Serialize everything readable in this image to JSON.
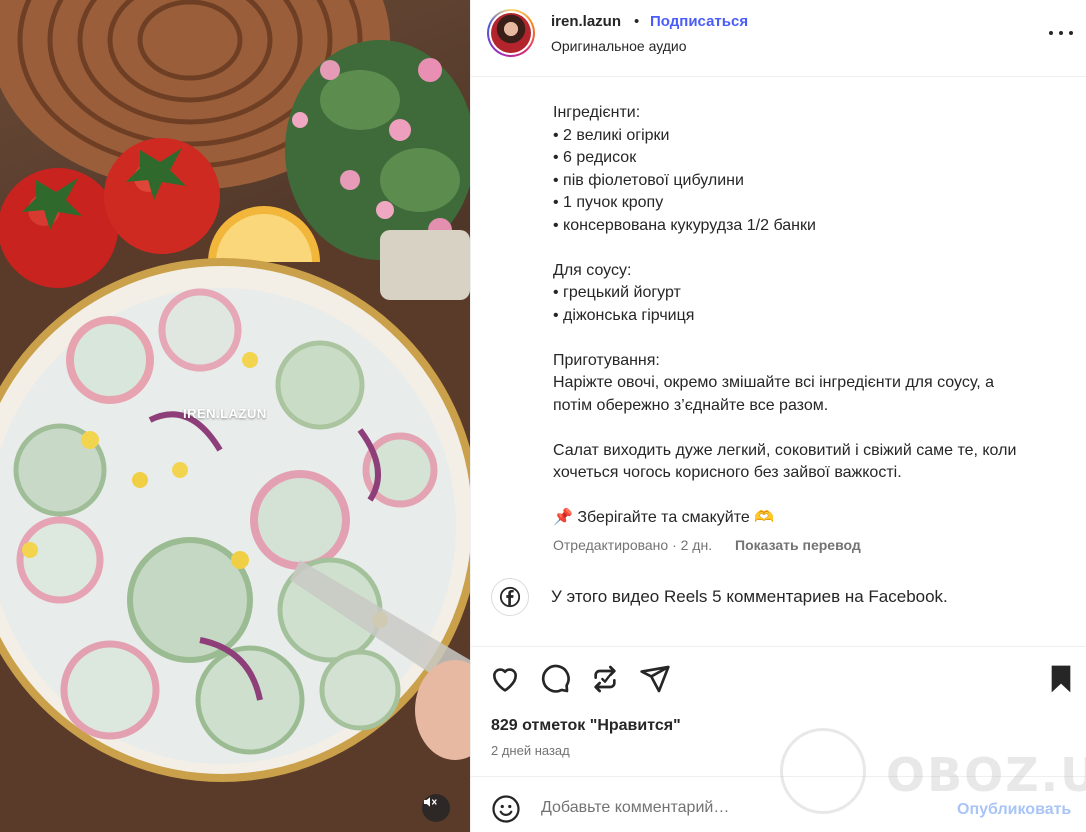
{
  "media": {
    "watermark": "IREN.LAZUN",
    "mute_icon": "speaker-muted-icon"
  },
  "header": {
    "username": "iren.lazun",
    "separator": "•",
    "follow_label": "Подписаться",
    "audio_label": "Оригинальное аудио",
    "more_icon": "more-horizontal-icon"
  },
  "caption": {
    "lines": [
      "Інгредієнти:",
      "• 2 великі огірки",
      "• 6 редисок",
      "• пів фіолетової цибулини",
      "• 1 пучок кропу",
      "• консервована кукурудза 1/2 банки",
      "",
      "Для соусу:",
      "• грецький йогурт",
      "• діжонська гірчиця",
      "",
      "Приготування:",
      "Наріжте овочі, окремо змішайте всі інгредієнти для соусу, а",
      "потім обережно з’єднайте все разом.",
      "",
      "Салат виходить дуже легкий, соковитий і свіжий саме те, коли",
      "хочеться чогось корисного без зайвої важкості.",
      "",
      "📌 Зберігайте та смакуйте 🫶"
    ],
    "meta": "Отредактировано · 2 дн.",
    "translate_label": "Показать перевод"
  },
  "facebook": {
    "icon": "facebook-icon",
    "text": "У этого видео Reels 5 комментариев на Facebook."
  },
  "actions": {
    "like_icon": "heart-icon",
    "comment_icon": "comment-icon",
    "share_icon": "repost-icon",
    "send_icon": "send-icon",
    "save_icon": "bookmark-icon",
    "likes_text": "829 отметок \"Нравится\"",
    "time_text": "2 дней назад"
  },
  "comment": {
    "emoji_icon": "emoji-icon",
    "placeholder": "Добавьте комментарий…",
    "publish_label": "Опубликовать"
  },
  "site_watermark": "OBOZ.UA"
}
